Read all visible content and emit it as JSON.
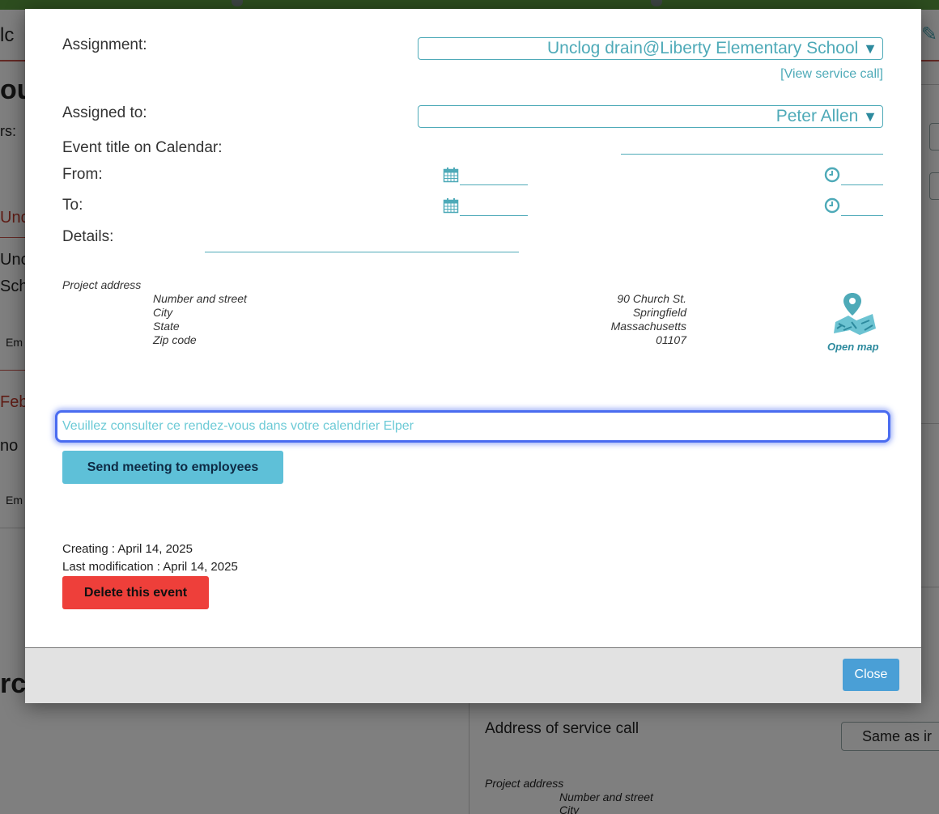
{
  "background": {
    "header_fragment": "lc",
    "heading_fragment": "ou",
    "label_rs": "rs:",
    "und_fragment": "Und",
    "unc_fragment": "Unc",
    "sch_fragment": "Sch",
    "em_fragment_1": "Em",
    "feb_fragment": "Feb",
    "no_fragment": "no",
    "em_fragment_2": "Em",
    "rc_fragment": "rc",
    "address_of_service_call": "Address of service call",
    "same_as_button": "Same as ir",
    "project_address": "Project address",
    "number_and_street": "Number and street",
    "city": "City"
  },
  "modal": {
    "assignment_label": "Assignment:",
    "assignment_value": "Unclog drain@Liberty Elementary School",
    "view_service_call": "[View service call]",
    "assigned_to_label": "Assigned to:",
    "assigned_to_value": "Peter Allen",
    "event_title_label": "Event title on Calendar:",
    "from_label": "From:",
    "to_label": "To:",
    "details_label": "Details:",
    "project_address": {
      "heading": "Project address",
      "fields": [
        "Number and street",
        "City",
        "State",
        "Zip code"
      ],
      "values": [
        "90 Church St.",
        "Springfield",
        "Massachusetts",
        "01107"
      ]
    },
    "open_map": "Open map",
    "message_placeholder": "Veuillez consulter ce rendez-vous dans votre calendrier Elper",
    "send_button": "Send meeting to employees",
    "creating": "Creating : April 14, 2025",
    "last_modification": "Last modification : April 14, 2025",
    "delete_button": "Delete this event",
    "close_button": "Close"
  },
  "colors": {
    "accent_teal": "#4eaab8",
    "focus_blue": "#4a6cf0",
    "send_button": "#5ec0d8",
    "delete_button": "#ee3f3a",
    "close_button": "#4a9fd6",
    "header_green": "#5a9a3e"
  },
  "icons": {
    "dropdown": "triangle-down",
    "date": "calendar-icon",
    "time": "clock-icon",
    "map": "map-pin-icon"
  }
}
